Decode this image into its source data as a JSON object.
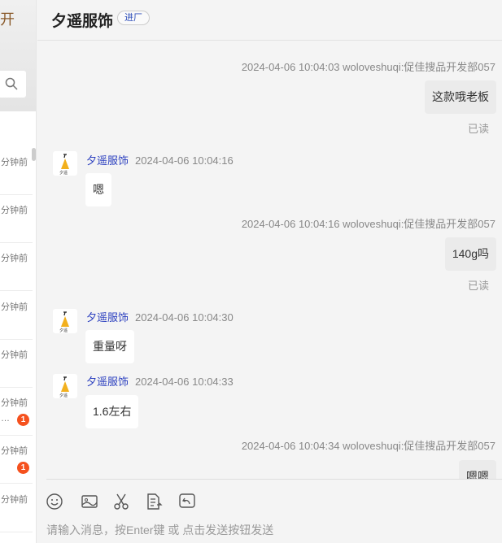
{
  "left": {
    "title": "开",
    "rows": [
      {
        "time": "分钟前"
      },
      {
        "time": "分钟前"
      },
      {
        "time": "分钟前"
      },
      {
        "time": "分钟前"
      },
      {
        "time": "分钟前"
      },
      {
        "time": "分钟前",
        "preview": "…",
        "badge": "1"
      },
      {
        "time": "分钟前",
        "badge": "1"
      },
      {
        "time": "分钟前"
      }
    ]
  },
  "header": {
    "title": "夕遥服饰",
    "tag": "进厂"
  },
  "messages": [
    {
      "dir": "out",
      "timestamp": "2024-04-06 10:04:03  woloveshuqi:促佳搜品开发部057",
      "text": "这款哦老板",
      "status": "已读"
    },
    {
      "dir": "in",
      "name": "夕遥服饰",
      "timestamp": "2024-04-06 10:04:16",
      "text": "嗯"
    },
    {
      "dir": "out",
      "timestamp": "2024-04-06 10:04:16  woloveshuqi:促佳搜品开发部057",
      "text": "140g吗",
      "status": "已读"
    },
    {
      "dir": "in",
      "name": "夕遥服饰",
      "timestamp": "2024-04-06 10:04:30",
      "text": "重量呀"
    },
    {
      "dir": "in",
      "name": "夕遥服饰",
      "timestamp": "2024-04-06 10:04:33",
      "text": "1.6左右"
    },
    {
      "dir": "out",
      "timestamp": "2024-04-06 10:04:34  woloveshuqi:促佳搜品开发部057",
      "text": "嗯嗯"
    }
  ],
  "input": {
    "placeholder": "请输入消息，按Enter键 或 点击发送按钮发送"
  },
  "toolbar": [
    "emoji-icon",
    "image-icon",
    "scissors-icon",
    "document-icon",
    "reply-icon"
  ],
  "colors": {
    "badge": "#f5511e",
    "name": "#2b3fbf"
  }
}
